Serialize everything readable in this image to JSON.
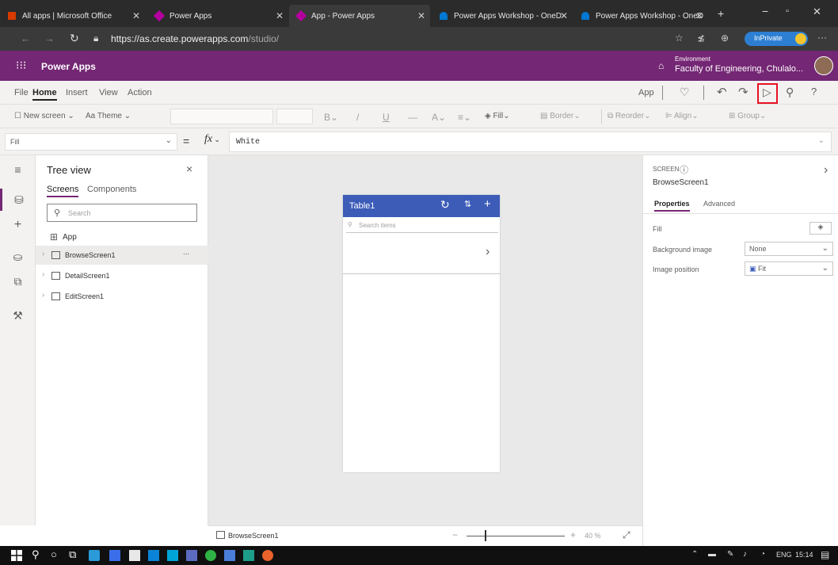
{
  "browser": {
    "tabs": [
      {
        "label": "All apps | Microsoft Office",
        "color": "#d83b01"
      },
      {
        "label": "Power Apps",
        "color": "#b4009e"
      },
      {
        "label": "App - Power Apps",
        "color": "#b4009e"
      },
      {
        "label": "Power Apps Workshop - OneD",
        "color": "#0078d4"
      },
      {
        "label": "Power Apps Workshop - OneD",
        "color": "#0078d4"
      }
    ],
    "url_host": "https://as.create.powerapps.com",
    "url_path": "/studio/",
    "inprivate": "InPrivate"
  },
  "header": {
    "app_name": "Power Apps",
    "env_label": "Environment",
    "env_name": "Faculty of Engineering, Chulalo..."
  },
  "menu": {
    "items": [
      "File",
      "Home",
      "Insert",
      "View",
      "Action"
    ],
    "app_label": "App"
  },
  "ribbon": {
    "new_screen": "New screen",
    "theme": "Theme",
    "fill": "Fill",
    "border": "Border",
    "reorder": "Reorder",
    "align": "Align",
    "group": "Group"
  },
  "formula": {
    "property": "Fill",
    "equals": "=",
    "fx": "fx",
    "value": "White"
  },
  "tree": {
    "title": "Tree view",
    "tab_screens": "Screens",
    "tab_components": "Components",
    "search_placeholder": "Search",
    "app": "App",
    "screens": [
      "BrowseScreen1",
      "DetailScreen1",
      "EditScreen1"
    ],
    "more": "..."
  },
  "phone": {
    "title": "Table1",
    "search_placeholder": "Search items"
  },
  "bottom": {
    "screen": "BrowseScreen1",
    "zoom": "40 %",
    "minus": "−",
    "plus": "+"
  },
  "props": {
    "kind": "SCREEN",
    "name": "BrowseScreen1",
    "tab_properties": "Properties",
    "tab_advanced": "Advanced",
    "fill_label": "Fill",
    "bg_label": "Background image",
    "bg_value": "None",
    "pos_label": "Image position",
    "pos_value": "Fit"
  },
  "taskbar": {
    "lang": "ENG",
    "time": "15:14"
  },
  "colors": {
    "brand": "#742774",
    "phone_header": "#3c5cb8",
    "highlight": "#e81123"
  }
}
